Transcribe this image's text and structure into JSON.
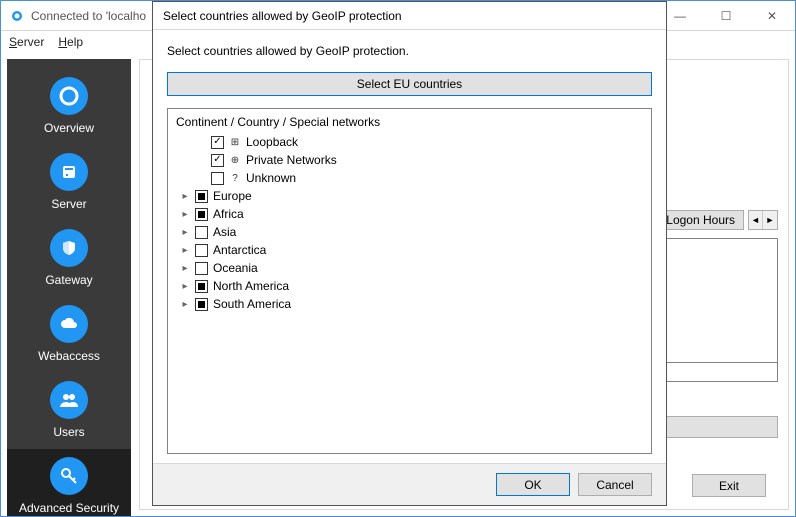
{
  "window": {
    "title": "Connected to 'localho",
    "min": "—",
    "max": "☐",
    "close": "✕"
  },
  "menubar": {
    "server": "Server",
    "help": "Help"
  },
  "sidebar": {
    "items": [
      {
        "label": "Overview",
        "icon": "donut"
      },
      {
        "label": "Server",
        "icon": "server"
      },
      {
        "label": "Gateway",
        "icon": "shield"
      },
      {
        "label": "Webaccess",
        "icon": "cloud"
      },
      {
        "label": "Users",
        "icon": "users"
      },
      {
        "label": "Advanced Security",
        "icon": "key"
      }
    ]
  },
  "main": {
    "logon_hours_tab": "Logon Hours",
    "exit": "Exit"
  },
  "dialog": {
    "title": "Select countries allowed by GeoIP protection",
    "instruction": "Select countries allowed by GeoIP protection.",
    "eu_button": "Select EU countries",
    "tree_header": "Continent / Country / Special networks",
    "ok": "OK",
    "cancel": "Cancel",
    "special": [
      {
        "label": "Loopback",
        "state": "checked",
        "icon": "⊞"
      },
      {
        "label": "Private Networks",
        "state": "checked",
        "icon": "⊕"
      },
      {
        "label": "Unknown",
        "state": "unchecked",
        "icon": "?"
      }
    ],
    "continents": [
      {
        "label": "Europe",
        "state": "indeterminate"
      },
      {
        "label": "Africa",
        "state": "indeterminate"
      },
      {
        "label": "Asia",
        "state": "unchecked"
      },
      {
        "label": "Antarctica",
        "state": "unchecked"
      },
      {
        "label": "Oceania",
        "state": "unchecked"
      },
      {
        "label": "North America",
        "state": "indeterminate"
      },
      {
        "label": "South America",
        "state": "indeterminate"
      }
    ]
  }
}
